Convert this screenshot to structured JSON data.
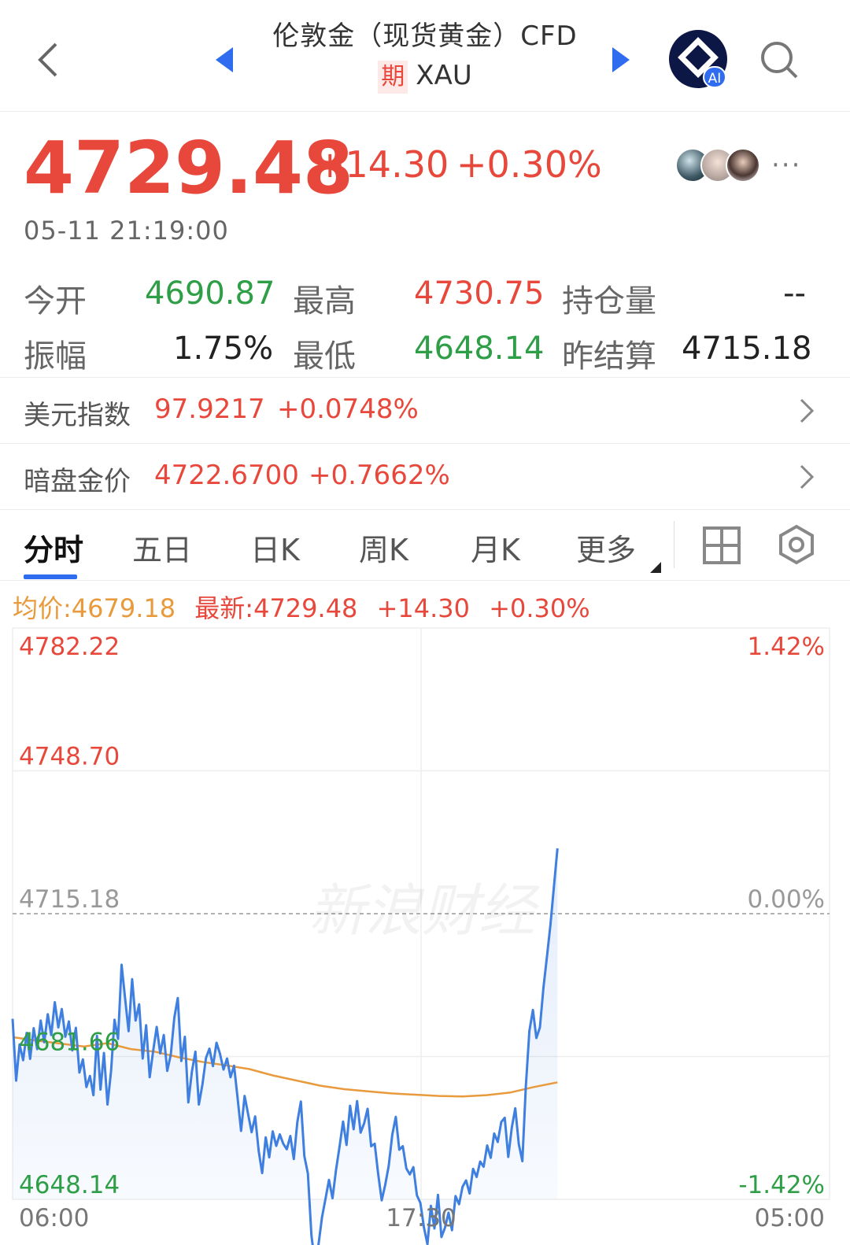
{
  "header": {
    "title": "伦敦金（现货黄金）CFD",
    "badge": "期",
    "code": "XAU",
    "ai_label": "AI"
  },
  "quote": {
    "price": "4729.48",
    "change": "+14.30",
    "change_pct": "+0.30%",
    "timestamp": "05-11 21:19:00",
    "more": "···"
  },
  "stats": {
    "open_label": "今开",
    "open_value": "4690.87",
    "high_label": "最高",
    "high_value": "4730.75",
    "oi_label": "持仓量",
    "oi_value": "--",
    "amp_label": "振幅",
    "amp_value": "1.75%",
    "low_label": "最低",
    "low_value": "4648.14",
    "settle_label": "昨结算",
    "settle_value": "4715.18"
  },
  "related": [
    {
      "label": "美元指数",
      "value": "97.9217",
      "change": "+0.0748%"
    },
    {
      "label": "暗盘金价",
      "value": "4722.6700",
      "change": "+0.7662%"
    }
  ],
  "tabs": [
    "分时",
    "五日",
    "日K",
    "周K",
    "月K",
    "更多"
  ],
  "legend": {
    "avg": "均价:4679.18",
    "latest": "最新:4729.48",
    "change": "+14.30",
    "pct": "+0.30%"
  },
  "colors": {
    "up": "#e8483b",
    "down": "#2e9e47",
    "line": "#3f7fe0",
    "avg_line": "#e89a3c",
    "accent": "#2f6cf0"
  },
  "icons": {
    "back": "chevron-left-icon",
    "prev": "triangle-left-icon",
    "next": "triangle-right-icon",
    "search": "search-icon",
    "grid": "grid-icon",
    "settings": "settings-icon"
  },
  "chart_data": {
    "type": "line",
    "watermark": "新浪财经",
    "y_labels_left": [
      "4782.22",
      "4748.70",
      "4715.18",
      "4681.66",
      "4648.14"
    ],
    "y_labels_right": [
      "1.42%",
      "",
      "0.00%",
      "",
      "-1.42%"
    ],
    "x_labels": [
      "06:00",
      "17:30",
      "05:00"
    ],
    "ylim": [
      4648.14,
      4782.22
    ],
    "prev_settle": 4715.18,
    "x_range": [
      "06:00",
      "05:00"
    ],
    "series": [
      {
        "values": [
          4690.5,
          4676.0,
          4684.5,
          4680.8,
          4687.2,
          4681.1,
          4688.3,
          4683.4,
          4690.1,
          4685.0,
          4691.6,
          4686.7,
          4694.4,
          4688.5,
          4692.8,
          4686.3,
          4689.9,
          4683.1,
          4688.4,
          4677.9,
          4681.0,
          4674.5,
          4677.1,
          4672.6,
          4686.5,
          4673.9,
          4682.5,
          4670.4,
          4678.2,
          4690.3,
          4685.8,
          4703.2,
          4695.4,
          4687.6,
          4699.8,
          4690.1,
          4693.9,
          4681.2,
          4689.0,
          4676.8,
          4683.1,
          4688.6,
          4682.4,
          4686.7,
          4678.3,
          4682.1,
          4690.8,
          4695.4,
          4680.6,
          4686.3,
          4670.9,
          4678.1,
          4682.8,
          4670.4,
          4675.1,
          4681.3,
          4683.5,
          4679.4,
          4684.9,
          4682.3,
          4678.6,
          4681.2,
          4676.8,
          4679.5,
          4671.9,
          4664.2,
          4672.4,
          4668.1,
          4663.9,
          4667.6,
          4659.5,
          4654.3,
          4662.7,
          4658.0,
          4664.1,
          4660.7,
          4663.4,
          4661.2,
          4659.9,
          4663.0,
          4657.6,
          4666.3,
          4671.1,
          4658.3,
          4654.2,
          4639.7,
          4633.1,
          4637.4,
          4643.9,
          4648.2,
          4652.7,
          4648.4,
          4655.0,
          4660.5,
          4666.4,
          4660.9,
          4670.1,
          4664.6,
          4671.2,
          4663.8,
          4666.0,
          4669.4,
          4660.6,
          4661.2,
          4654.1,
          4647.9,
          4651.6,
          4656.0,
          4663.3,
          4667.5,
          4659.8,
          4660.6,
          4655.4,
          4654.0,
          4655.7,
          4649.1,
          4647.3,
          4641.6,
          4637.6,
          4646.6,
          4641.3,
          4649.2,
          4639.3,
          4641.5,
          4645.0,
          4640.9,
          4648.9,
          4647.0,
          4651.1,
          4652.6,
          4649.5,
          4655.3,
          4653.4,
          4657.0,
          4655.8,
          4660.8,
          4657.9,
          4663.6,
          4661.6,
          4666.3,
          4667.3,
          4658.1,
          4665.0,
          4669.5,
          4661.1,
          4657.1,
          4674.6,
          4687.6,
          4692.6,
          4686.0,
          4688.5,
          4697.8,
          4705.0,
          4712.6,
          4721.7,
          4730.5
        ]
      }
    ],
    "avg_line": [
      4686.2,
      4685.4,
      4684.7,
      4684.0,
      4684.8,
      4683.4,
      4682.8,
      4681.5,
      4680.4,
      4679.6,
      4678.7,
      4677.2,
      4676.0,
      4674.8,
      4674.0,
      4673.5,
      4673.0,
      4672.7,
      4672.4,
      4672.3,
      4672.6,
      4673.2,
      4674.5,
      4675.6
    ]
  }
}
